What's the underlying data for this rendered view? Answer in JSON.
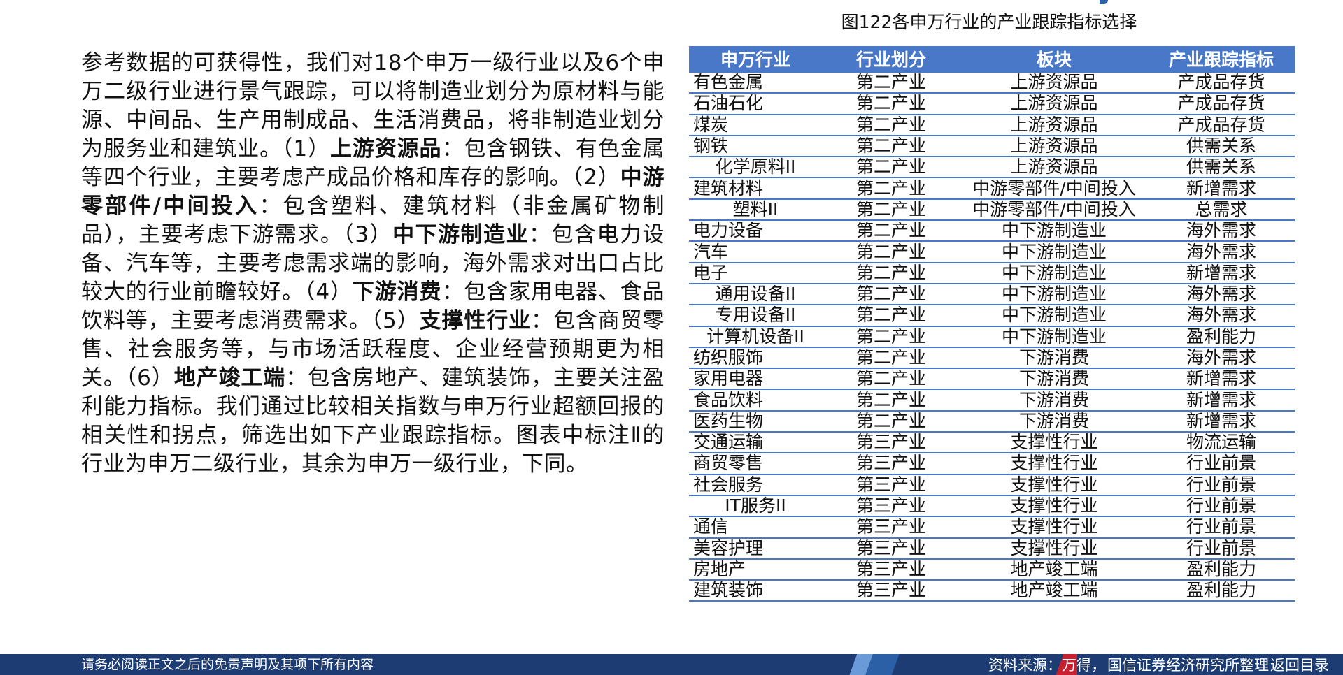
{
  "body": {
    "segments": [
      {
        "text": "参考数据的可获得性，我们对18个申万一级行业以及6个申万二级行业进行景气跟踪，可以将制造业划分为原材料与能源、中间品、生产用制成品、生活消费品，将非制造业划分为服务业和建筑业。（1）",
        "bold": false
      },
      {
        "text": "上游资源品",
        "bold": true
      },
      {
        "text": "：包含钢铁、有色金属等四个行业，主要考虑产成品价格和库存的影响。（2）",
        "bold": false
      },
      {
        "text": "中游零部件/中间投入",
        "bold": true
      },
      {
        "text": "：包含塑料、建筑材料（非金属矿物制品），主要考虑下游需求。（3）",
        "bold": false
      },
      {
        "text": "中下游制造业",
        "bold": true
      },
      {
        "text": "：包含电力设备、汽车等，主要考虑需求端的影响，海外需求对出口占比较大的行业前瞻较好。（4）",
        "bold": false
      },
      {
        "text": "下游消费",
        "bold": true
      },
      {
        "text": "：包含家用电器、食品饮料等，主要考虑消费需求。（5）",
        "bold": false
      },
      {
        "text": "支撑性行业",
        "bold": true
      },
      {
        "text": "：包含商贸零售、社会服务等，与市场活跃程度、企业经营预期更为相关。（6）",
        "bold": false
      },
      {
        "text": "地产竣工端",
        "bold": true
      },
      {
        "text": "：包含房地产、建筑装饰，主要关注盈利能力指标。我们通过比较相关指数与申万行业超额回报的相关性和拐点，筛选出如下产业跟踪指标。图表中标注Ⅱ的行业为申万二级行业，其余为申万一级行业，下同。",
        "bold": false
      }
    ]
  },
  "figure": {
    "title": "图122各申万行业的产业跟踪指标选择",
    "headers": [
      "申万行业",
      "行业划分",
      "板块",
      "产业跟踪指标"
    ],
    "rows": [
      {
        "industry": "有色金属",
        "sub": false,
        "division": "第二产业",
        "sector": "上游资源品",
        "indicator": "产成品存货"
      },
      {
        "industry": "石油石化",
        "sub": false,
        "division": "第二产业",
        "sector": "上游资源品",
        "indicator": "产成品存货"
      },
      {
        "industry": "煤炭",
        "sub": false,
        "division": "第二产业",
        "sector": "上游资源品",
        "indicator": "产成品存货"
      },
      {
        "industry": "钢铁",
        "sub": false,
        "division": "第二产业",
        "sector": "上游资源品",
        "indicator": "供需关系"
      },
      {
        "industry": "化学原料II",
        "sub": true,
        "division": "第二产业",
        "sector": "上游资源品",
        "indicator": "供需关系"
      },
      {
        "industry": "建筑材料",
        "sub": false,
        "division": "第二产业",
        "sector": "中游零部件/中间投入",
        "indicator": "新增需求"
      },
      {
        "industry": "塑料II",
        "sub": true,
        "division": "第二产业",
        "sector": "中游零部件/中间投入",
        "indicator": "总需求"
      },
      {
        "industry": "电力设备",
        "sub": false,
        "division": "第二产业",
        "sector": "中下游制造业",
        "indicator": "海外需求"
      },
      {
        "industry": "汽车",
        "sub": false,
        "division": "第二产业",
        "sector": "中下游制造业",
        "indicator": "海外需求"
      },
      {
        "industry": "电子",
        "sub": false,
        "division": "第二产业",
        "sector": "中下游制造业",
        "indicator": "新增需求"
      },
      {
        "industry": "通用设备II",
        "sub": true,
        "division": "第二产业",
        "sector": "中下游制造业",
        "indicator": "海外需求"
      },
      {
        "industry": "专用设备II",
        "sub": true,
        "division": "第二产业",
        "sector": "中下游制造业",
        "indicator": "海外需求"
      },
      {
        "industry": "计算机设备II",
        "sub": true,
        "division": "第二产业",
        "sector": "中下游制造业",
        "indicator": "盈利能力"
      },
      {
        "industry": "纺织服饰",
        "sub": false,
        "division": "第二产业",
        "sector": "下游消费",
        "indicator": "海外需求"
      },
      {
        "industry": "家用电器",
        "sub": false,
        "division": "第二产业",
        "sector": "下游消费",
        "indicator": "新增需求"
      },
      {
        "industry": "食品饮料",
        "sub": false,
        "division": "第二产业",
        "sector": "下游消费",
        "indicator": "新增需求"
      },
      {
        "industry": "医药生物",
        "sub": false,
        "division": "第二产业",
        "sector": "下游消费",
        "indicator": "新增需求"
      },
      {
        "industry": "交通运输",
        "sub": false,
        "division": "第三产业",
        "sector": "支撑性行业",
        "indicator": "物流运输"
      },
      {
        "industry": "商贸零售",
        "sub": false,
        "division": "第三产业",
        "sector": "支撑性行业",
        "indicator": "行业前景"
      },
      {
        "industry": "社会服务",
        "sub": false,
        "division": "第三产业",
        "sector": "支撑性行业",
        "indicator": "行业前景"
      },
      {
        "industry": "IT服务II",
        "sub": true,
        "division": "第三产业",
        "sector": "支撑性行业",
        "indicator": "行业前景"
      },
      {
        "industry": "通信",
        "sub": false,
        "division": "第三产业",
        "sector": "支撑性行业",
        "indicator": "行业前景"
      },
      {
        "industry": "美容护理",
        "sub": false,
        "division": "第三产业",
        "sector": "支撑性行业",
        "indicator": "行业前景"
      },
      {
        "industry": "房地产",
        "sub": false,
        "division": "第三产业",
        "sector": "地产竣工端",
        "indicator": "盈利能力"
      },
      {
        "industry": "建筑装饰",
        "sub": false,
        "division": "第三产业",
        "sector": "地产竣工端",
        "indicator": "盈利能力"
      }
    ]
  },
  "footer": {
    "disclaimer": "请务必阅读正文之后的免责声明及其项下所有内容",
    "source_prefix": "资料来源：万得，",
    "source_org": "国信证券经济研究所整理",
    "back_link": "返回目录"
  },
  "colors": {
    "header_bg": "#4a78c8",
    "footer_bg": "#1c3c73",
    "accent_red": "#c8202f"
  }
}
